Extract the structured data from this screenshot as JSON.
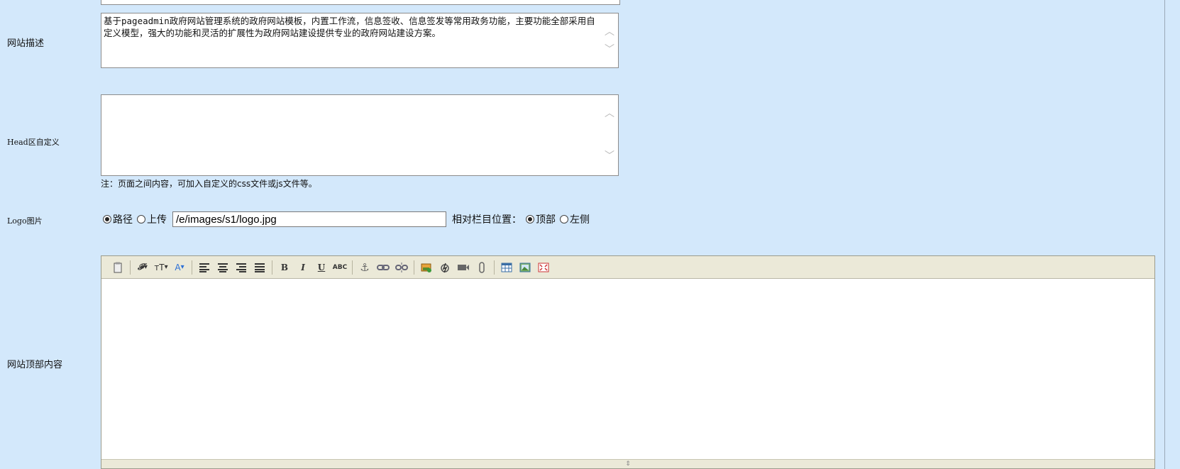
{
  "fields": {
    "description": {
      "label": "网站描述",
      "value": "基于pageadmin政府网站管理系统的政府网站模板，内置工作流，信息签收、信息签发等常用政务功能，主要功能全部采用自定义模型，强大的功能和灵活的扩展性为政府网站建设提供专业的政府网站建设方案。"
    },
    "head_custom": {
      "label": "Head区自定义",
      "value": "",
      "note": "注：页面之间内容，可加入自定义的css文件或js文件等。"
    },
    "logo": {
      "label": "Logo图片",
      "source_options": [
        "路径",
        "上传"
      ],
      "source_selected": "路径",
      "path_value": "/e/images/s1/logo.jpg",
      "position_label": "相对栏目位置：",
      "position_options": [
        "顶部",
        "左侧"
      ],
      "position_selected": "顶部"
    },
    "top_content": {
      "label": "网站顶部内容",
      "value": ""
    }
  },
  "editor_toolbar": {
    "icons": [
      "paste-icon",
      "font-family-icon",
      "font-size-icon",
      "font-color-icon",
      "align-left-icon",
      "align-center-icon",
      "align-right-icon",
      "justify-icon",
      "bold-icon",
      "italic-icon",
      "underline-icon",
      "strikethrough-icon",
      "anchor-icon",
      "link-icon",
      "unlink-icon",
      "insert-image-icon",
      "flash-icon",
      "media-icon",
      "attachment-icon",
      "table-icon",
      "image-gallery-icon",
      "fullscreen-icon"
    ],
    "glyphs": {
      "font_family": "𝓕",
      "font_size": "тT",
      "font_color": "A",
      "bold": "B",
      "italic": "I",
      "underline": "U",
      "strike": "ABC"
    }
  },
  "colors": {
    "background": "#d3e8fb",
    "toolbar": "#ebe9d8"
  }
}
